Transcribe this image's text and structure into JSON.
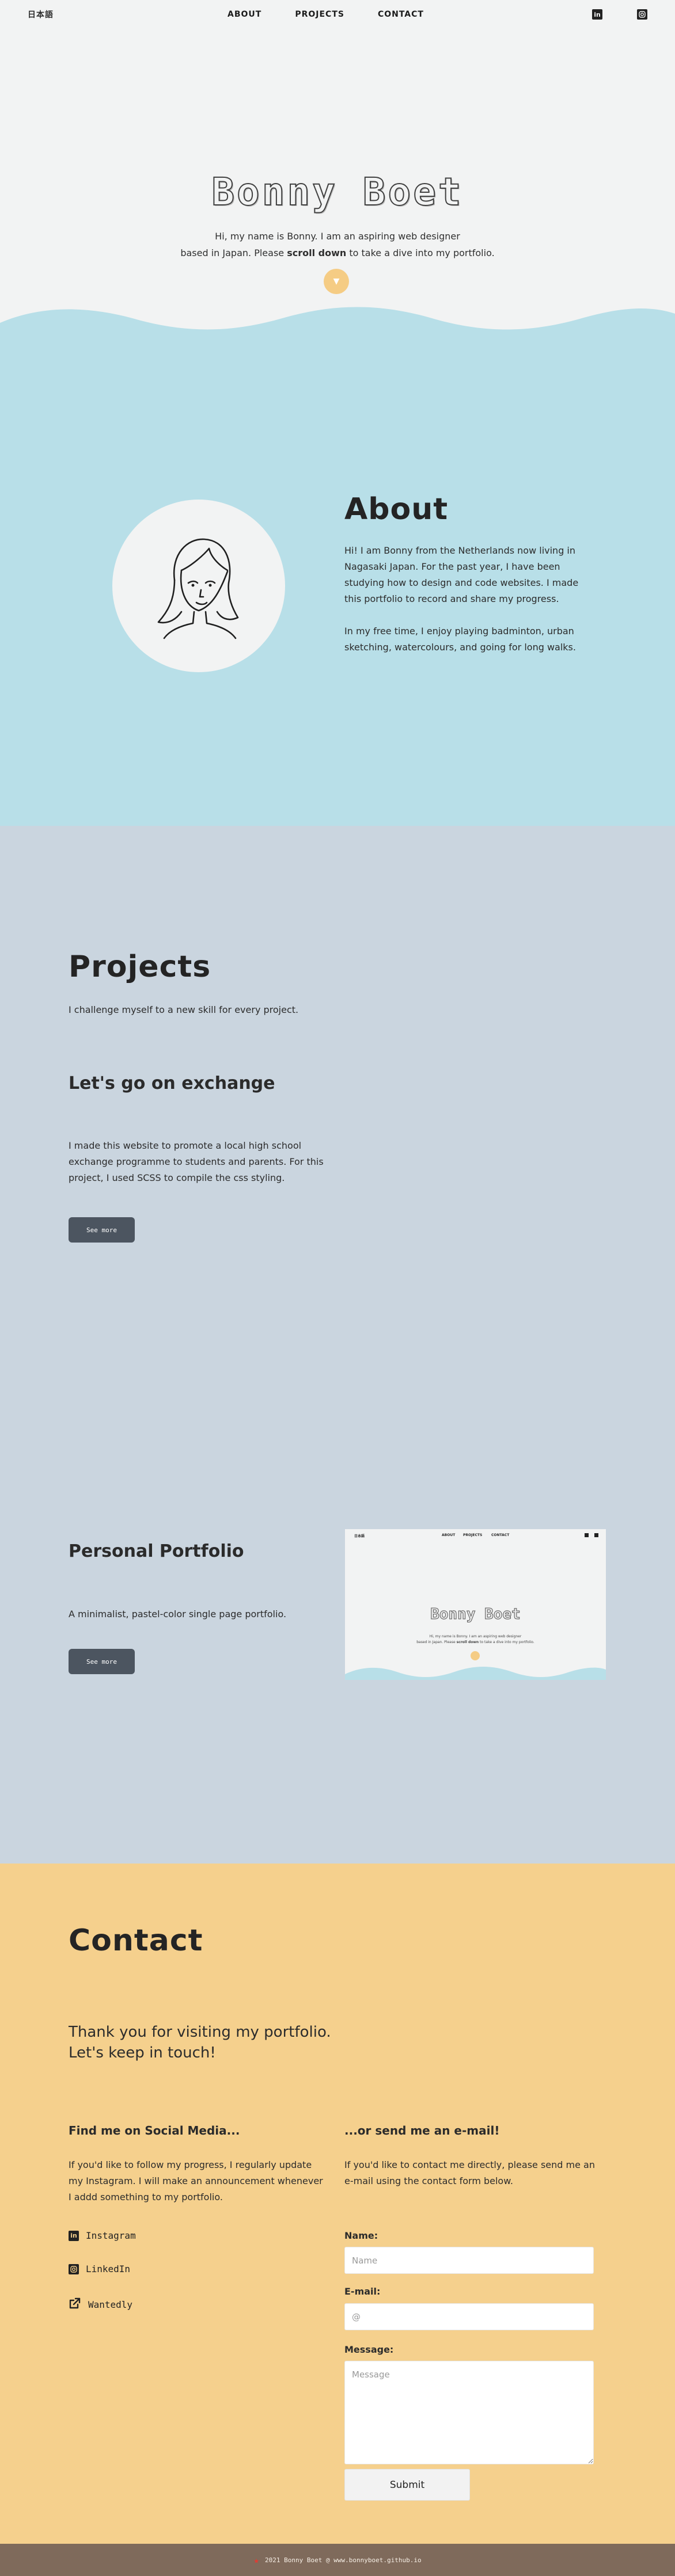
{
  "nav": {
    "lang": "日本語",
    "links": [
      "ABOUT",
      "PROJECTS",
      "CONTACT"
    ],
    "icons": [
      "linkedin-icon",
      "instagram-icon"
    ]
  },
  "hero": {
    "title": "Bonny Boet",
    "line1": "Hi, my name is Bonny. I am an aspiring web designer",
    "line2_prefix": "based in Japan. Please ",
    "line2_bold": "scroll down",
    "line2_suffix": " to take a dive into my portfolio.",
    "scroll_icon": "chevron-down-icon"
  },
  "about": {
    "title": "About",
    "p1": "Hi! I am Bonny from the Netherlands now living in Nagasaki Japan. For the past year, I have been studying how to design and code websites. I made this portfolio to record and share my progress.",
    "p2": "In my free time, I enjoy playing badminton, urban sketching, watercolours, and going for long walks."
  },
  "projects": {
    "title": "Projects",
    "intro": "I challenge myself to a new skill for every project.",
    "items": [
      {
        "name": "Let's go on exchange",
        "desc": "I made this website to promote a local high school exchange programme to students and parents. For this project, I used SCSS to compile the css styling.",
        "button": "See more"
      },
      {
        "name": "Personal Portfolio",
        "desc": "A minimalist, pastel-color single page portfolio.",
        "button": "See more"
      }
    ],
    "thumb": {
      "lang": "日本語",
      "links": [
        "ABOUT",
        "PROJECTS",
        "CONTACT"
      ],
      "title": "Bonny Boet",
      "line1": "Hi, my name is Bonny. I am an aspiring web designer",
      "line2_prefix": "based in Japan. Please ",
      "line2_bold": "scroll down",
      "line2_suffix": " to take a dive into my portfolio."
    }
  },
  "contact": {
    "title": "Contact",
    "thanks1": "Thank you for visiting my portfolio.",
    "thanks2": "Let's keep in touch!",
    "social_heading": "Find me on Social Media...",
    "social_text": "If you'd like to follow my progress, I regularly update my Instagram. I will make an announcement whenever I addd something to my portfolio.",
    "social_links": [
      "Instagram",
      "LinkedIn",
      "Wantedly"
    ],
    "email_heading": "...or send me an e-mail!",
    "email_text": "If you'd like to contact me directly, please send me an e-mail using the contact form below.",
    "name_label": "Name:",
    "name_placeholder": "Name",
    "email_label": "E-mail:",
    "email_placeholder": "@",
    "message_label": "Message:",
    "message_placeholder": "Message",
    "submit": "Submit"
  },
  "footer": {
    "text": "2021 Bonny Boet @ www.bonnyboet.github.io"
  },
  "colors": {
    "hero_bg": "#f2f3f3",
    "about_bg": "#b8dfe8",
    "projects_bg": "#cad5df",
    "contact_bg": "#f5d08d",
    "footer_bg": "#7f6a5b",
    "accent": "#f5cc84"
  }
}
